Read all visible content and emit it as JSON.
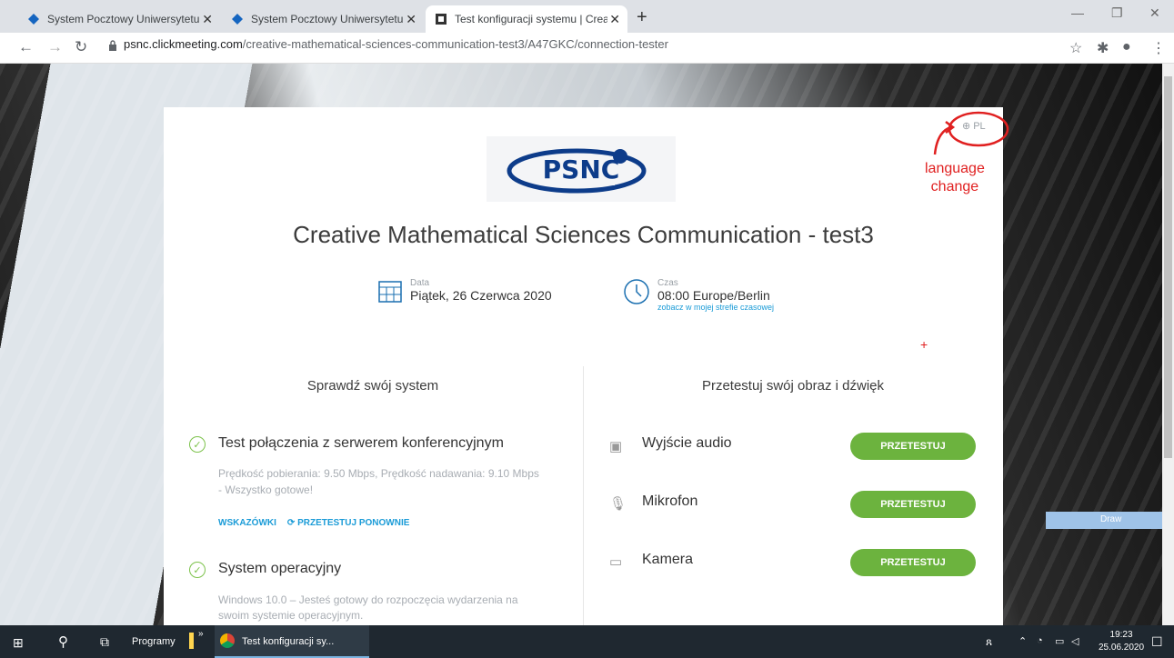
{
  "browser": {
    "tabs": [
      {
        "title": "System Pocztowy Uniwersytetu in",
        "active": false
      },
      {
        "title": "System Pocztowy Uniwersytetu in",
        "active": false
      },
      {
        "title": "Test konfiguracji systemu | Creati",
        "active": true
      }
    ],
    "url_host": "psnc.clickmeeting.com",
    "url_path": "/creative-mathematical-sciences-communication-test3/A47GKC/connection-tester"
  },
  "card": {
    "logo_text": "PSNC",
    "lang": "PL",
    "title": "Creative Mathematical Sciences Communication - test3",
    "date_label": "Data",
    "date_value": "Piątek, 26 Czerwca 2020",
    "time_label": "Czas",
    "time_value": "08:00 Europe/Berlin",
    "time_link": "zobacz w mojej strefie czasowej",
    "left_head": "Sprawdź swój system",
    "right_head": "Przetestuj swój obraz i dźwięk",
    "conn_title": "Test połączenia z serwerem konferencyjnym",
    "conn_desc1": "Prędkość pobierania: 9.50 Mbps, Prędkość nadawania: 9.10 Mbps",
    "conn_desc2": "- Wszystko gotowe!",
    "link_hints": "WSKAZÓWKI",
    "link_retest": "PRZETESTUJ PONOWNIE",
    "os_title": "System operacyjny",
    "os_desc1": "Windows 10.0 – Jesteś gotowy do rozpoczęcia wydarzenia na",
    "os_desc2": "swoim systemie operacyjnym.",
    "audio_label": "Wyjście audio",
    "mic_label": "Mikrofon",
    "cam_label": "Kamera",
    "btn_label": "PRZETESTUJ"
  },
  "annotation": {
    "line1": "language",
    "line2": "change",
    "color": "#e02020"
  },
  "draw_label": "Draw",
  "taskbar": {
    "programs": "Programy",
    "app": "Test konfiguracji sy...",
    "time": "19:23",
    "date": "25.06.2020"
  }
}
